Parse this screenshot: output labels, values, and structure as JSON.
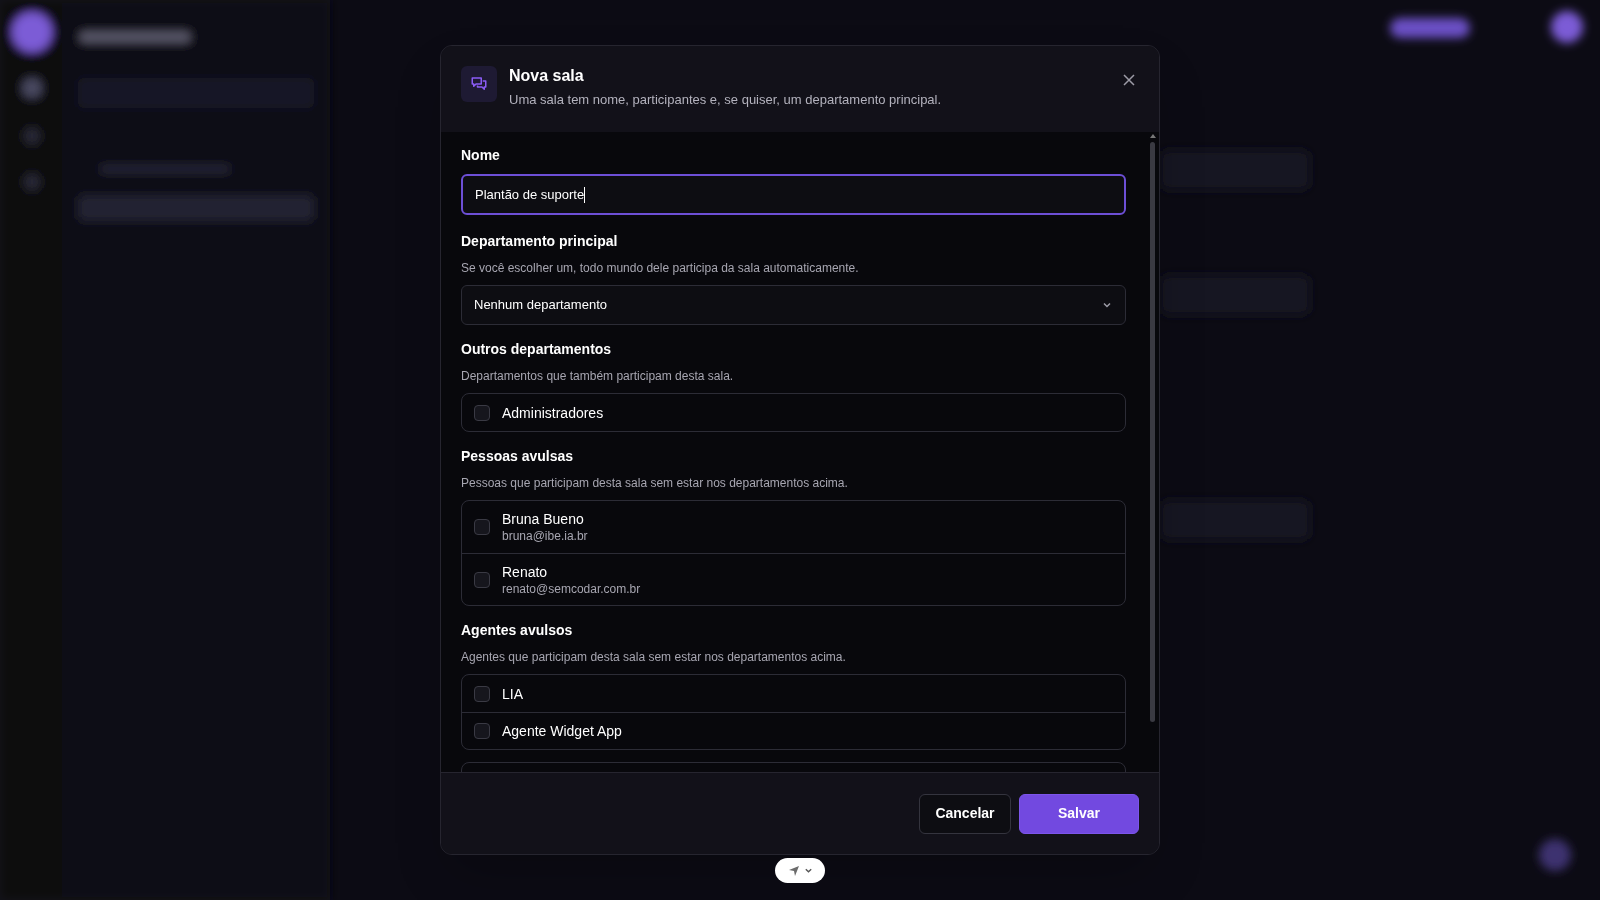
{
  "dialog": {
    "title": "Nova sala",
    "subtitle": "Uma sala tem nome, participantes e, se quiser, um departamento principal.",
    "name_field": {
      "label": "Nome",
      "value": "Plantão de suporte"
    },
    "main_department": {
      "label": "Departamento principal",
      "hint": "Se você escolher um, todo mundo dele participa da sala automaticamente.",
      "value": "Nenhum departamento"
    },
    "sections": [
      {
        "title": "Outros departamentos",
        "hint": "Departamentos que também participam desta sala.",
        "items": [
          {
            "name": "Administradores",
            "checked": false
          }
        ]
      },
      {
        "title": "Pessoas avulsas",
        "hint": "Pessoas que participam desta sala sem estar nos departamentos acima.",
        "items": [
          {
            "name": "Bruna Bueno",
            "email": "bruna@ibe.ia.br",
            "checked": false
          },
          {
            "name": "Renato",
            "email": "renato@semcodar.com.br",
            "checked": false
          }
        ]
      },
      {
        "title": "Agentes avulsos",
        "hint": "Agentes que participam desta sala sem estar nos departamentos acima.",
        "items": [
          {
            "name": "LIA",
            "checked": false
          },
          {
            "name": "Agente Widget App",
            "checked": false
          }
        ]
      }
    ],
    "buttons": [
      {
        "label": "Cancelar",
        "kind": "secondary"
      },
      {
        "label": "Salvar",
        "kind": "primary"
      }
    ]
  }
}
